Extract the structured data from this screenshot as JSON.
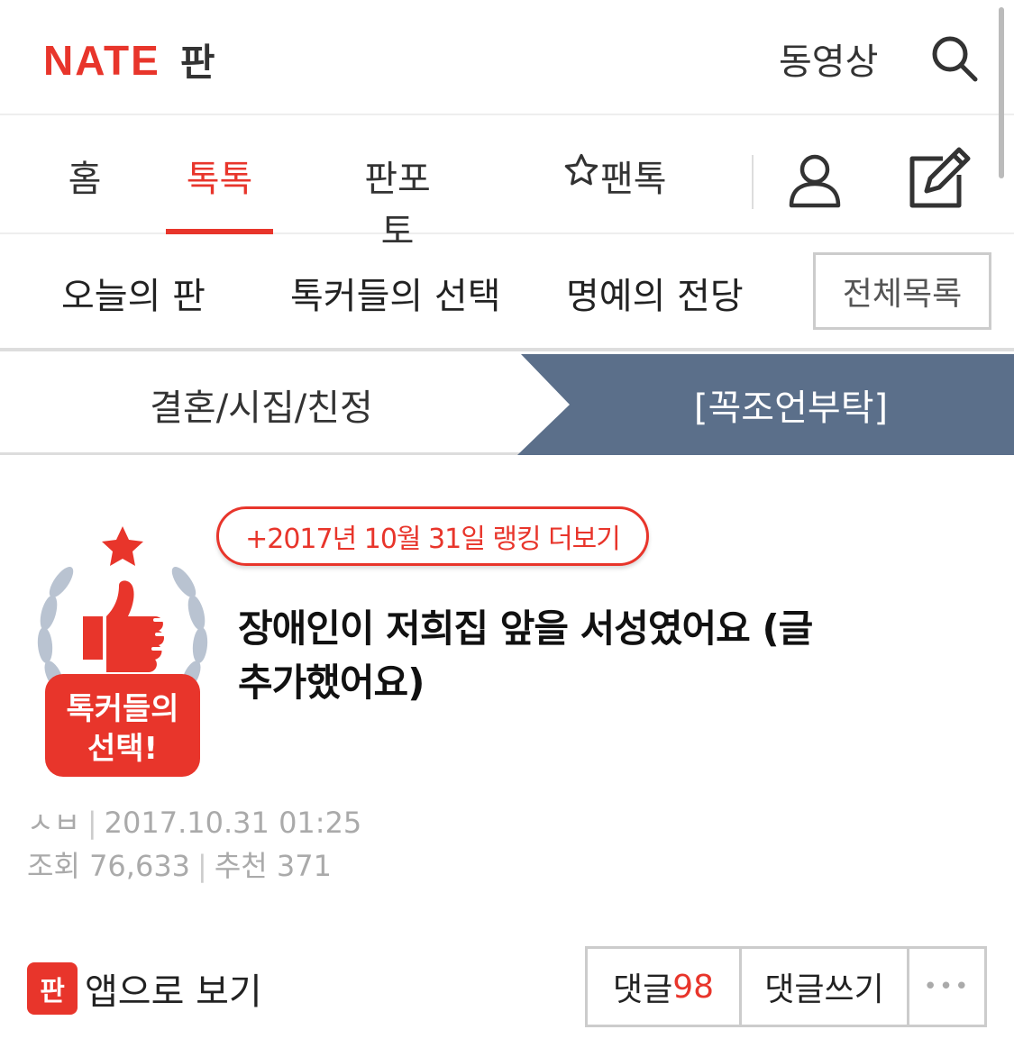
{
  "header": {
    "logo_brand": "NATE",
    "logo_section": "판",
    "video_label": "동영상"
  },
  "nav": {
    "tabs": [
      {
        "label": "홈"
      },
      {
        "label": "톡톡"
      },
      {
        "label": "판포토"
      },
      {
        "label": "팬톡"
      }
    ],
    "active_tab": "톡톡"
  },
  "subnav": {
    "items": [
      {
        "label": "오늘의 판"
      },
      {
        "label": "톡커들의 선택"
      },
      {
        "label": "명예의 전당"
      }
    ],
    "all_list_label": "전체목록"
  },
  "breadcrumb": {
    "category": "결혼/시집/친정",
    "subcategory": "[꼭조언부탁]",
    "accent_color": "#5b6f8a"
  },
  "post": {
    "rank_link": "+2017년 10월 31일 랭킹 더보기",
    "badge_text_line1": "톡커들의",
    "badge_text_line2": "선택!",
    "title": "장애인이 저희집 앞을 서성였어요 (글 추가했어요)",
    "author": "ㅅㅂ",
    "datetime": "2017.10.31 01:25",
    "views_label": "조회",
    "views": "76,633",
    "recommend_label": "추천",
    "recommend": "371"
  },
  "actions": {
    "app_icon_text": "판",
    "app_label": "앱으로 보기",
    "comments_label": "댓글",
    "comments_count": "98",
    "write_comment_label": "댓글쓰기",
    "more_label": "•••"
  },
  "colors": {
    "brand": "#e8352b"
  }
}
